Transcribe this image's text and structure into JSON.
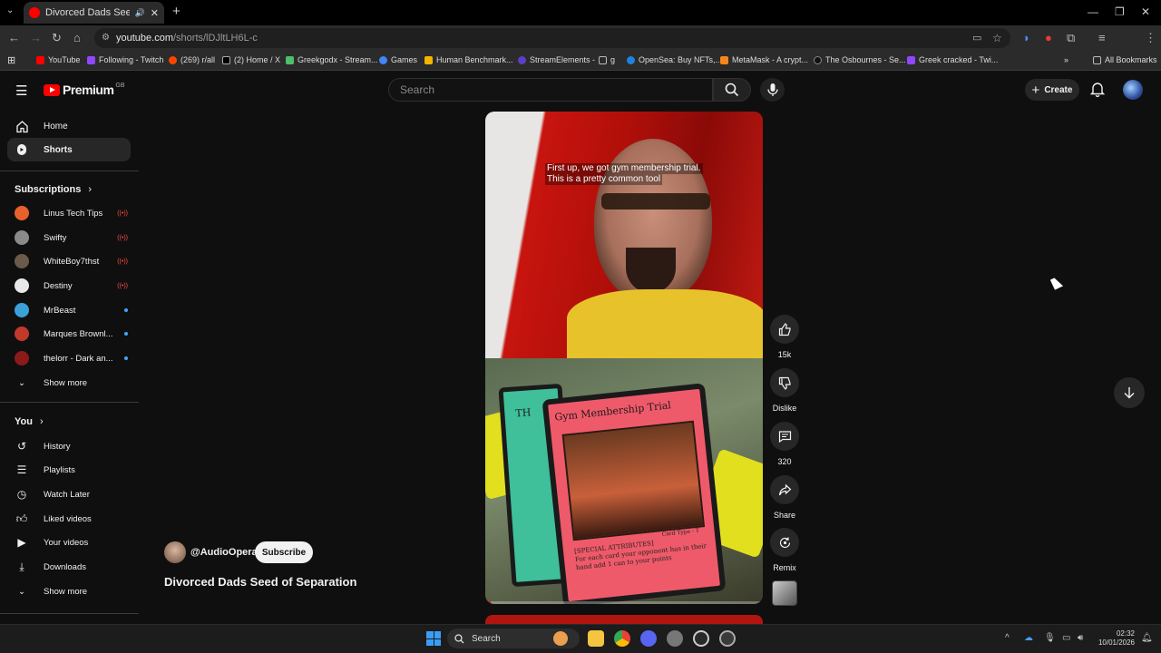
{
  "browser": {
    "tab_title": "Divorced Dads Seed of Sep",
    "url_domain": "youtube.com",
    "url_path": "/shorts/lDJltLH6L-c",
    "bookmarks": [
      "YouTube",
      "Following - Twitch",
      "(269) r/all",
      "(2) Home / X",
      "Greekgodx - Stream...",
      "Games",
      "Human Benchmark...",
      "StreamElements -",
      "g",
      "OpenSea: Buy NFTs,...",
      "MetaMask - A crypt...",
      "The Osbournes - Se...",
      "Greek cracked - Twi..."
    ],
    "all_bookmarks": "All Bookmarks"
  },
  "header": {
    "logo_text": "Premium",
    "logo_region": "GB",
    "search_placeholder": "Search",
    "create_label": "Create"
  },
  "sidebar": {
    "home": "Home",
    "shorts": "Shorts",
    "subscriptions_heading": "Subscriptions",
    "subscriptions": [
      {
        "name": "Linus Tech Tips",
        "status": "live",
        "color": "#e8612c"
      },
      {
        "name": "Swifty",
        "status": "live",
        "color": "#8a8a8a"
      },
      {
        "name": "WhiteBoy7thst",
        "status": "live",
        "color": "#6b5a4a"
      },
      {
        "name": "Destiny",
        "status": "live",
        "color": "#e8e8e8"
      },
      {
        "name": "MrBeast",
        "status": "new",
        "color": "#3aa0d8"
      },
      {
        "name": "Marques Brownl...",
        "status": "new",
        "color": "#c0392b"
      },
      {
        "name": "thelorr - Dark an...",
        "status": "new",
        "color": "#8b1a1a"
      }
    ],
    "show_more_1": "Show more",
    "you_heading": "You",
    "you_items": [
      "History",
      "Playlists",
      "Watch Later",
      "Liked videos",
      "Your videos",
      "Downloads"
    ],
    "show_more_2": "Show more",
    "live_label": "((•))"
  },
  "short": {
    "caption_line1": "First up, we got gym membership trial.",
    "caption_line2": "This is a pretty common tool",
    "card_title": "Gym Membership Trial",
    "card_type": "Card Type - T",
    "card_text_1": "[SPECIAL ATTRIBUTES]",
    "card_text_2": "For each card your opponent has in their hand add 1 can to your points",
    "side_card_letters": "TH",
    "progress": 0.02,
    "channel": "@AudioOpera",
    "subscribe": "Subscribe",
    "title": "Divorced Dads Seed of Separation"
  },
  "actions": {
    "likes": "15k",
    "dislike": "Dislike",
    "comments": "320",
    "share": "Share",
    "remix": "Remix"
  },
  "taskbar": {
    "search": "Search",
    "time": "02:32",
    "date": "10/01/2026"
  }
}
